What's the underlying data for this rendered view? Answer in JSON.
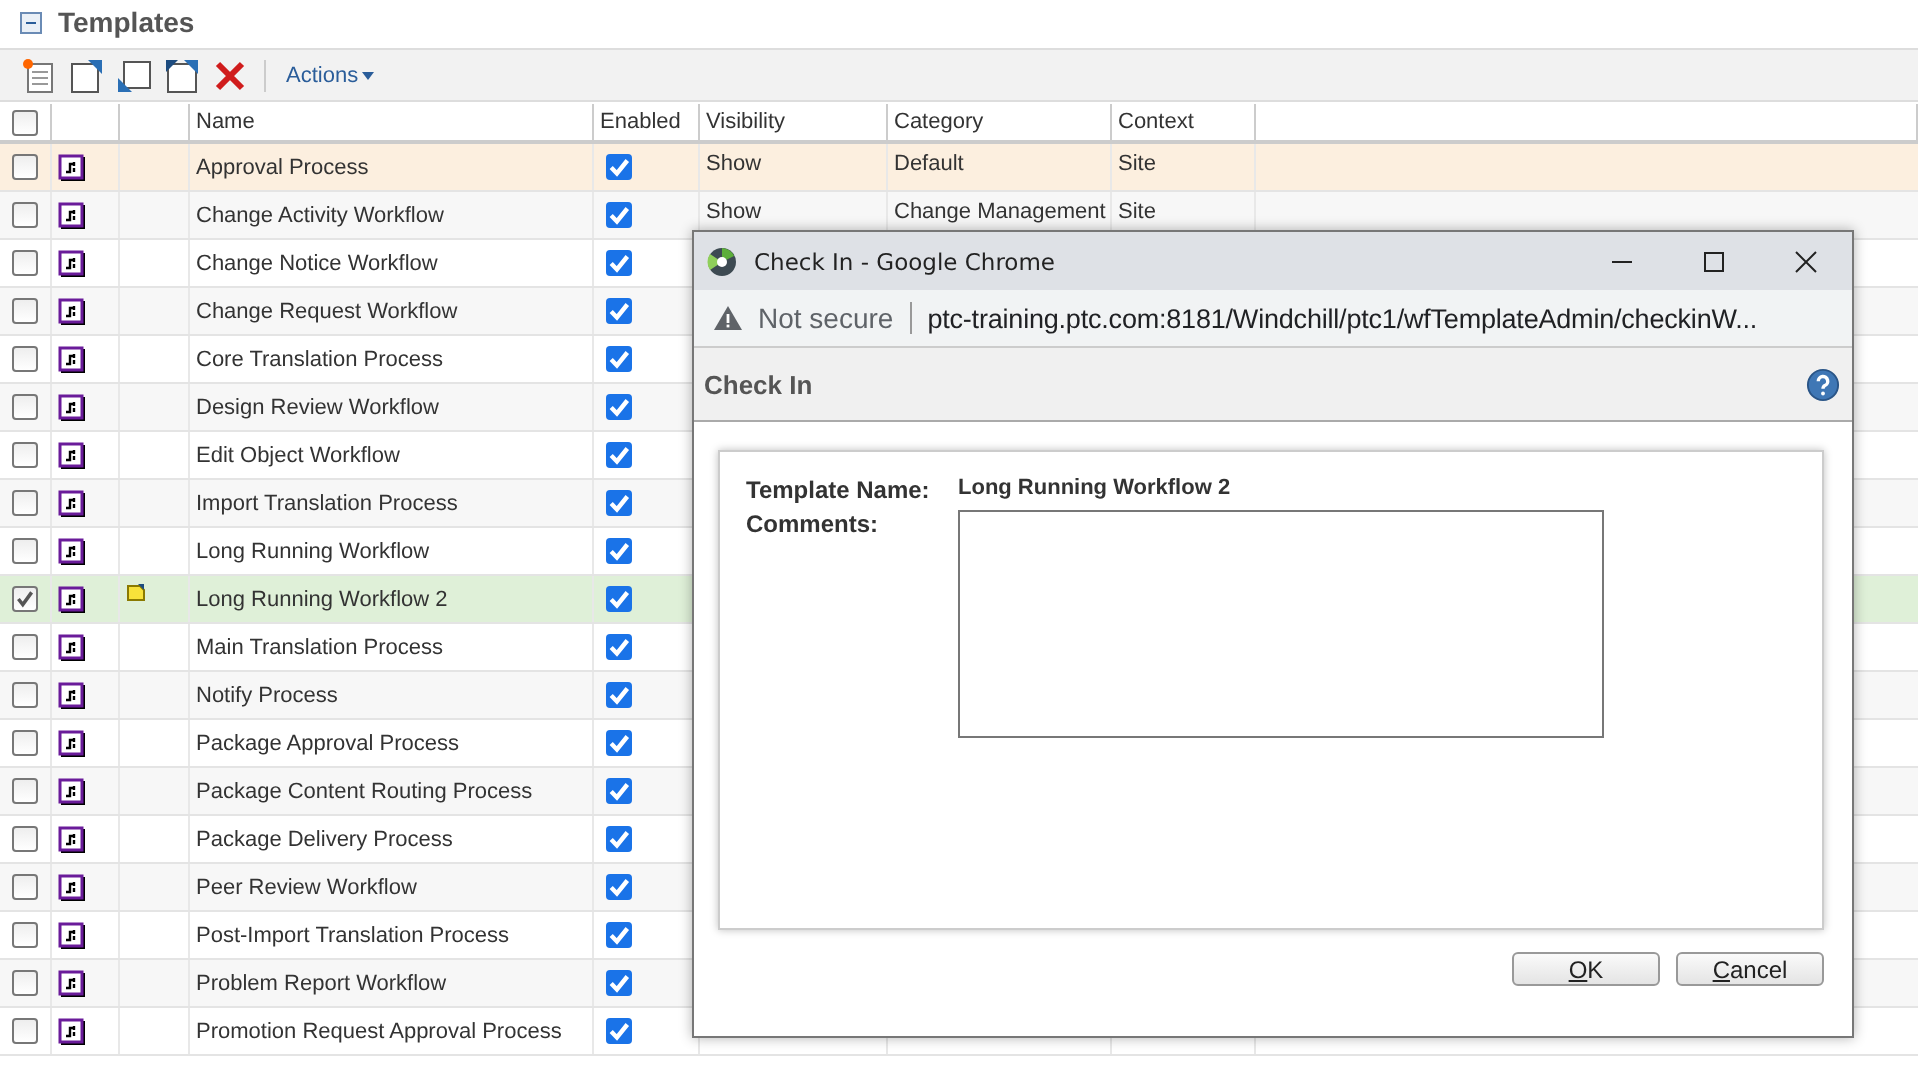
{
  "section": {
    "title": "Templates",
    "expanded": true
  },
  "toolbar": {
    "actions_label": "Actions"
  },
  "table": {
    "select_all_checked": false,
    "columns": [
      "Name",
      "Enabled",
      "Visibility",
      "Category",
      "Context"
    ],
    "rows": [
      {
        "name": "Approval Process",
        "checked": false,
        "enabled": true,
        "highlighted": true,
        "checked_out": false,
        "visibility": "Show",
        "category": "Default",
        "context": "Site"
      },
      {
        "name": "Change Activity Workflow",
        "checked": false,
        "enabled": true,
        "highlighted": false,
        "checked_out": false,
        "visibility": "Show",
        "category": "Change Management",
        "context": "Site"
      },
      {
        "name": "Change Notice Workflow",
        "checked": false,
        "enabled": true,
        "highlighted": false,
        "checked_out": false
      },
      {
        "name": "Change Request Workflow",
        "checked": false,
        "enabled": true,
        "highlighted": false,
        "checked_out": false
      },
      {
        "name": "Core Translation Process",
        "checked": false,
        "enabled": true,
        "highlighted": false,
        "checked_out": false
      },
      {
        "name": "Design Review Workflow",
        "checked": false,
        "enabled": true,
        "highlighted": false,
        "checked_out": false
      },
      {
        "name": "Edit Object Workflow",
        "checked": false,
        "enabled": true,
        "highlighted": false,
        "checked_out": false
      },
      {
        "name": "Import Translation Process",
        "checked": false,
        "enabled": true,
        "highlighted": false,
        "checked_out": false
      },
      {
        "name": "Long Running Workflow",
        "checked": false,
        "enabled": true,
        "highlighted": false,
        "checked_out": false
      },
      {
        "name": "Long Running Workflow 2",
        "checked": true,
        "enabled": true,
        "highlighted": false,
        "checked_out": true
      },
      {
        "name": "Main Translation Process",
        "checked": false,
        "enabled": true,
        "highlighted": false,
        "checked_out": false
      },
      {
        "name": "Notify Process",
        "checked": false,
        "enabled": true,
        "highlighted": false,
        "checked_out": false
      },
      {
        "name": "Package Approval Process",
        "checked": false,
        "enabled": true,
        "highlighted": false,
        "checked_out": false
      },
      {
        "name": "Package Content Routing Process",
        "checked": false,
        "enabled": true,
        "highlighted": false,
        "checked_out": false
      },
      {
        "name": "Package Delivery Process",
        "checked": false,
        "enabled": true,
        "highlighted": false,
        "checked_out": false
      },
      {
        "name": "Peer Review Workflow",
        "checked": false,
        "enabled": true,
        "highlighted": false,
        "checked_out": false
      },
      {
        "name": "Post-Import Translation Process",
        "checked": false,
        "enabled": true,
        "highlighted": false,
        "checked_out": false
      },
      {
        "name": "Problem Report Workflow",
        "checked": false,
        "enabled": true,
        "highlighted": false,
        "checked_out": false
      },
      {
        "name": "Promotion Request Approval Process",
        "checked": false,
        "enabled": true,
        "highlighted": false,
        "checked_out": false
      }
    ]
  },
  "popup": {
    "window_title": "Check In - Google Chrome",
    "security": "Not secure",
    "url": "ptc-training.ptc.com:8181/Windchill/ptc1/wfTemplateAdmin/checkinW...",
    "heading": "Check In",
    "fields": [
      {
        "label": "Template Name:",
        "value": "Long Running Workflow 2"
      },
      {
        "label": "Comments:"
      }
    ],
    "buttons": [
      "OK",
      "Cancel"
    ]
  }
}
